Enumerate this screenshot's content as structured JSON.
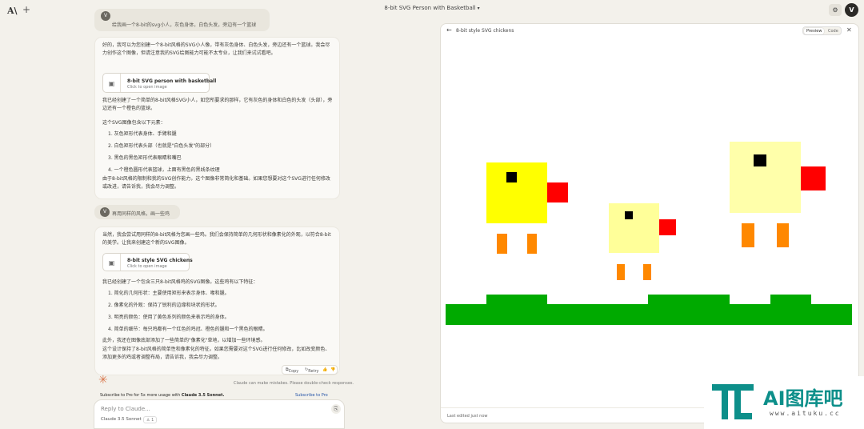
{
  "header": {
    "logo": "A\\",
    "new_chat": "+",
    "title": "8-bit SVG Person with Basketball",
    "settings_icon": "sliders-icon",
    "avatar": "V"
  },
  "messages": [
    {
      "role": "user",
      "avatar": "V",
      "text": "给我画一个8-bit的svg小人，灰色身体，白色头发，旁边有一个篮球"
    },
    {
      "role": "assistant",
      "intro": "好的，我可以为您创建一个8-bit风格的SVG小人像，带有灰色身体、白色头发，旁边还有一个篮球。我会尽力创作这个图像，但请注意我的SVG绘图能力可能不太专业，让我们来试试看吧。",
      "artifact": {
        "title": "8-bit SVG person with basketball",
        "subtitle": "Click to open image"
      },
      "after": "我已经创建了一个简单的8-bit风格SVG小人，如您所要求的那样，它有灰色的身体和白色的头发（头部），旁边还有一个橙色的篮球。",
      "list_intro": "这个SVG图像包含以下元素：",
      "items": [
        "灰色矩形代表身体、手臂和腿",
        "白色矩形代表头部（也就是\"白色头发\"的部分）",
        "黑色的黑色矩形代表眼睛和嘴巴",
        "一个橙色圆形代表篮球，上面有黑色的黑线条纹理"
      ],
      "closing": "由于8-bit风格的限制和我的SVG创作能力，这个图像非常简化和基础。如果您想要对这个SVG进行任何修改或改进，请告诉我，我会尽力调整。"
    },
    {
      "role": "user",
      "avatar": "V",
      "text": "再用同样的风格，画一些鸡"
    },
    {
      "role": "assistant",
      "intro": "当然，我会尝试用同样的8-bit风格为您画一些鸡。我们会保持简单的几何形状和像素化的外观，以符合8-bit的美学。让我来创建这个新的SVG图像。",
      "artifact": {
        "title": "8-bit style SVG chickens",
        "subtitle": "Click to open image"
      },
      "after": "我已经创建了一个包含三只8-bit风格鸡的SVG图像。这些鸡有以下特征：",
      "items": [
        "简化的几何形状：主要使用矩形来表示身体、喙和腿。",
        "像素化的外观：保持了锐利的边缘和块状的形状。",
        "明亮的颜色：使用了黄色系列的颜色来表示鸡的身体。",
        "简单的细节：每只鸡都有一个红色的鸡冠、橙色的腿和一个黑色的眼睛。"
      ],
      "extra": "此外，我还在图像底部添加了一些简单的\"像素化\"草地，以增加一些环境感。",
      "closing": "这个设计保持了8-bit风格的简单性和像素化的特征。如果您需要对这个SVG进行任何修改，比如改变颜色、添加更多的鸡或者调整布局，请告诉我，我会尽力调整。",
      "actions": [
        "Copy",
        "Retry",
        "👍",
        "👎"
      ]
    }
  ],
  "disclaimer": "Claude can make mistakes. Please double-check responses.",
  "pro_bar": {
    "text": "Subscribe to Pro for 5x more usage with",
    "model": "Claude 3.5 Sonnet.",
    "link": "Subscribe to Pro"
  },
  "composer": {
    "placeholder": "Reply to Claude...",
    "model": "Claude 3.5 Sonnet",
    "badge": "1",
    "attach_icon": "paperclip-icon"
  },
  "panel": {
    "title": "8-bit style SVG chickens",
    "tabs": [
      "Preview",
      "Code"
    ],
    "active_tab": "Preview",
    "footer": "Last edited just now",
    "colors": {
      "ground": "#00aa00",
      "chicken1": "#ffff00",
      "chicken2": "#ffff99",
      "chicken3": "#ffffaa",
      "comb": "#ff0000",
      "legs": "#ff8800",
      "eye": "#000000"
    }
  },
  "watermark": {
    "text": "AI图库吧",
    "url": "www.aituku.cc"
  }
}
